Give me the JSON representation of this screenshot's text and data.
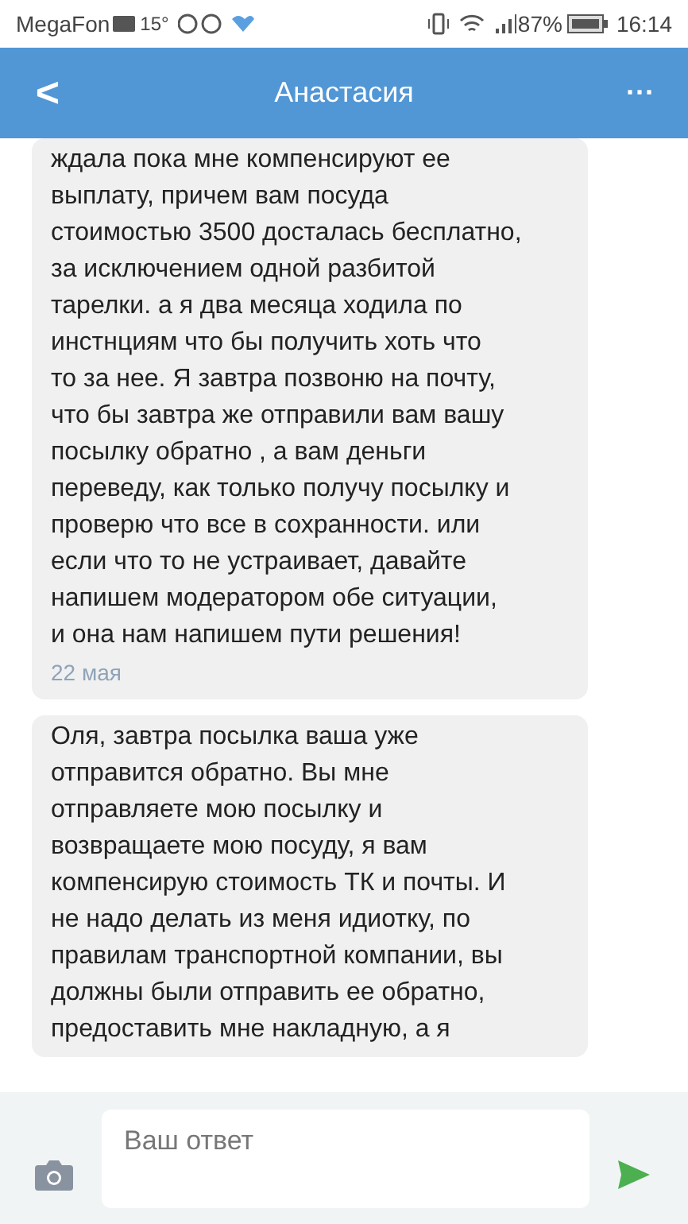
{
  "status_bar": {
    "carrier": "MegaFon",
    "temperature": "15°",
    "battery": "87%",
    "time": "16:14"
  },
  "header": {
    "title": "Анастасия",
    "back": "<",
    "more": "···"
  },
  "messages": [
    {
      "text": "ждала пока мне компенсируют ее\nвыплату, причем вам посуда\nстоимостью 3500 досталась бесплатно,\nза исключением одной разбитой\nтарелки. а я два месяца ходила по\nинстнциям что бы получить хоть что\nто за нее. Я завтра позвоню на почту,\nчто бы завтра же отправили вам вашу\nпосылку обратно , а вам деньги\nпереведу, как только получу посылку и\nпроверю что все в сохранности. или\nесли что то не устраивает, давайте\nнапишем модератором обе ситуации,\nи она нам напишем пути решения!",
      "date": "22 мая"
    },
    {
      "text": "Оля, завтра посылка ваша уже\nотправится обратно. Вы мне\nотправляете мою посылку и\nвозвращаете мою посуду, я вам\nкомпенсирую стоимость ТК и почты. И\nне надо делать из меня идиотку, по\nправилам транспортной компании, вы\nдолжны были отправить ее обратно,\nпредоставить мне накладную, а я"
    }
  ],
  "composer": {
    "placeholder": "Ваш ответ"
  }
}
